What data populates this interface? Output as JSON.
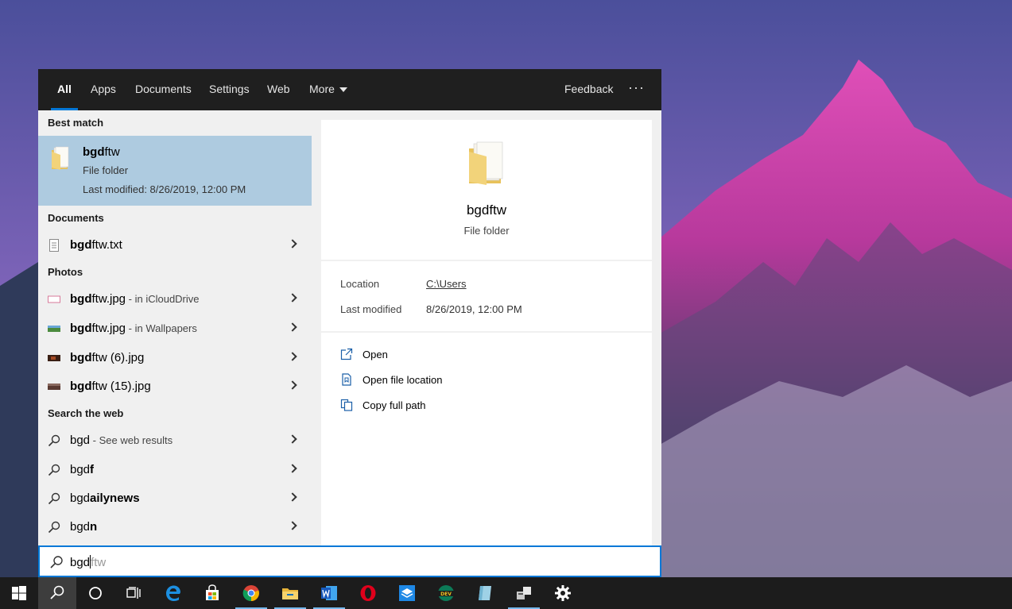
{
  "tabs": [
    {
      "label": "All",
      "active": true
    },
    {
      "label": "Apps"
    },
    {
      "label": "Documents"
    },
    {
      "label": "Settings"
    },
    {
      "label": "Web"
    },
    {
      "label": "More"
    }
  ],
  "topbar": {
    "feedback": "Feedback",
    "ellipsis": "···"
  },
  "sections": {
    "best_match": "Best match",
    "documents": "Documents",
    "photos": "Photos",
    "web": "Search the web"
  },
  "best_match": {
    "title_bold": "bgd",
    "title_rest": "ftw",
    "type": "File folder",
    "modified": "Last modified: 8/26/2019, 12:00 PM",
    "icon": "folder-icon"
  },
  "documents": [
    {
      "bold": "bgd",
      "rest": "ftw.txt",
      "sub": "",
      "icon": "text-file-icon"
    }
  ],
  "photos": [
    {
      "bold": "bgd",
      "rest": "ftw.jpg",
      "sub": " - in iCloudDrive",
      "icon": "image-thumb-icon"
    },
    {
      "bold": "bgd",
      "rest": "ftw.jpg",
      "sub": " - in Wallpapers",
      "icon": "image-thumb-icon"
    },
    {
      "bold": "bgd",
      "rest": "ftw (6).jpg",
      "sub": "",
      "icon": "image-thumb-icon"
    },
    {
      "bold": "bgd",
      "rest": "ftw (15).jpg",
      "sub": "",
      "icon": "image-thumb-icon"
    }
  ],
  "web": [
    {
      "plain": "bgd",
      "bold": "",
      "sub": " - See web results",
      "icon": "search-icon"
    },
    {
      "plain": "bgd",
      "bold": "f",
      "sub": "",
      "icon": "search-icon"
    },
    {
      "plain": "bgd",
      "bold": "ailynews",
      "sub": "",
      "icon": "search-icon"
    },
    {
      "plain": "bgd",
      "bold": "n",
      "sub": "",
      "icon": "search-icon"
    }
  ],
  "preview": {
    "title": "bgdftw",
    "type": "File folder",
    "location_label": "Location",
    "location_value": "C:\\Users",
    "modified_label": "Last modified",
    "modified_value": "8/26/2019, 12:00 PM",
    "actions": [
      {
        "label": "Open",
        "icon": "open-external-icon"
      },
      {
        "label": "Open file location",
        "icon": "file-location-icon"
      },
      {
        "label": "Copy full path",
        "icon": "copy-icon"
      }
    ]
  },
  "searchbox": {
    "typed": "bgd",
    "suggestion": "ftw"
  },
  "taskbar": {
    "items": [
      "windows-start-icon",
      "search-icon",
      "cortana-icon",
      "task-view-icon",
      "edge-icon",
      "store-icon",
      "chrome-icon",
      "file-explorer-icon",
      "word-icon",
      "opera-icon",
      "box-app-icon",
      "edge-dev-icon",
      "ruler-app-icon",
      "network-app-icon",
      "settings-icon"
    ]
  },
  "colors": {
    "accent": "#0078d7",
    "selection": "#aecbe0",
    "topbar": "#1f1f1f",
    "taskbar": "#1c1c1c"
  }
}
